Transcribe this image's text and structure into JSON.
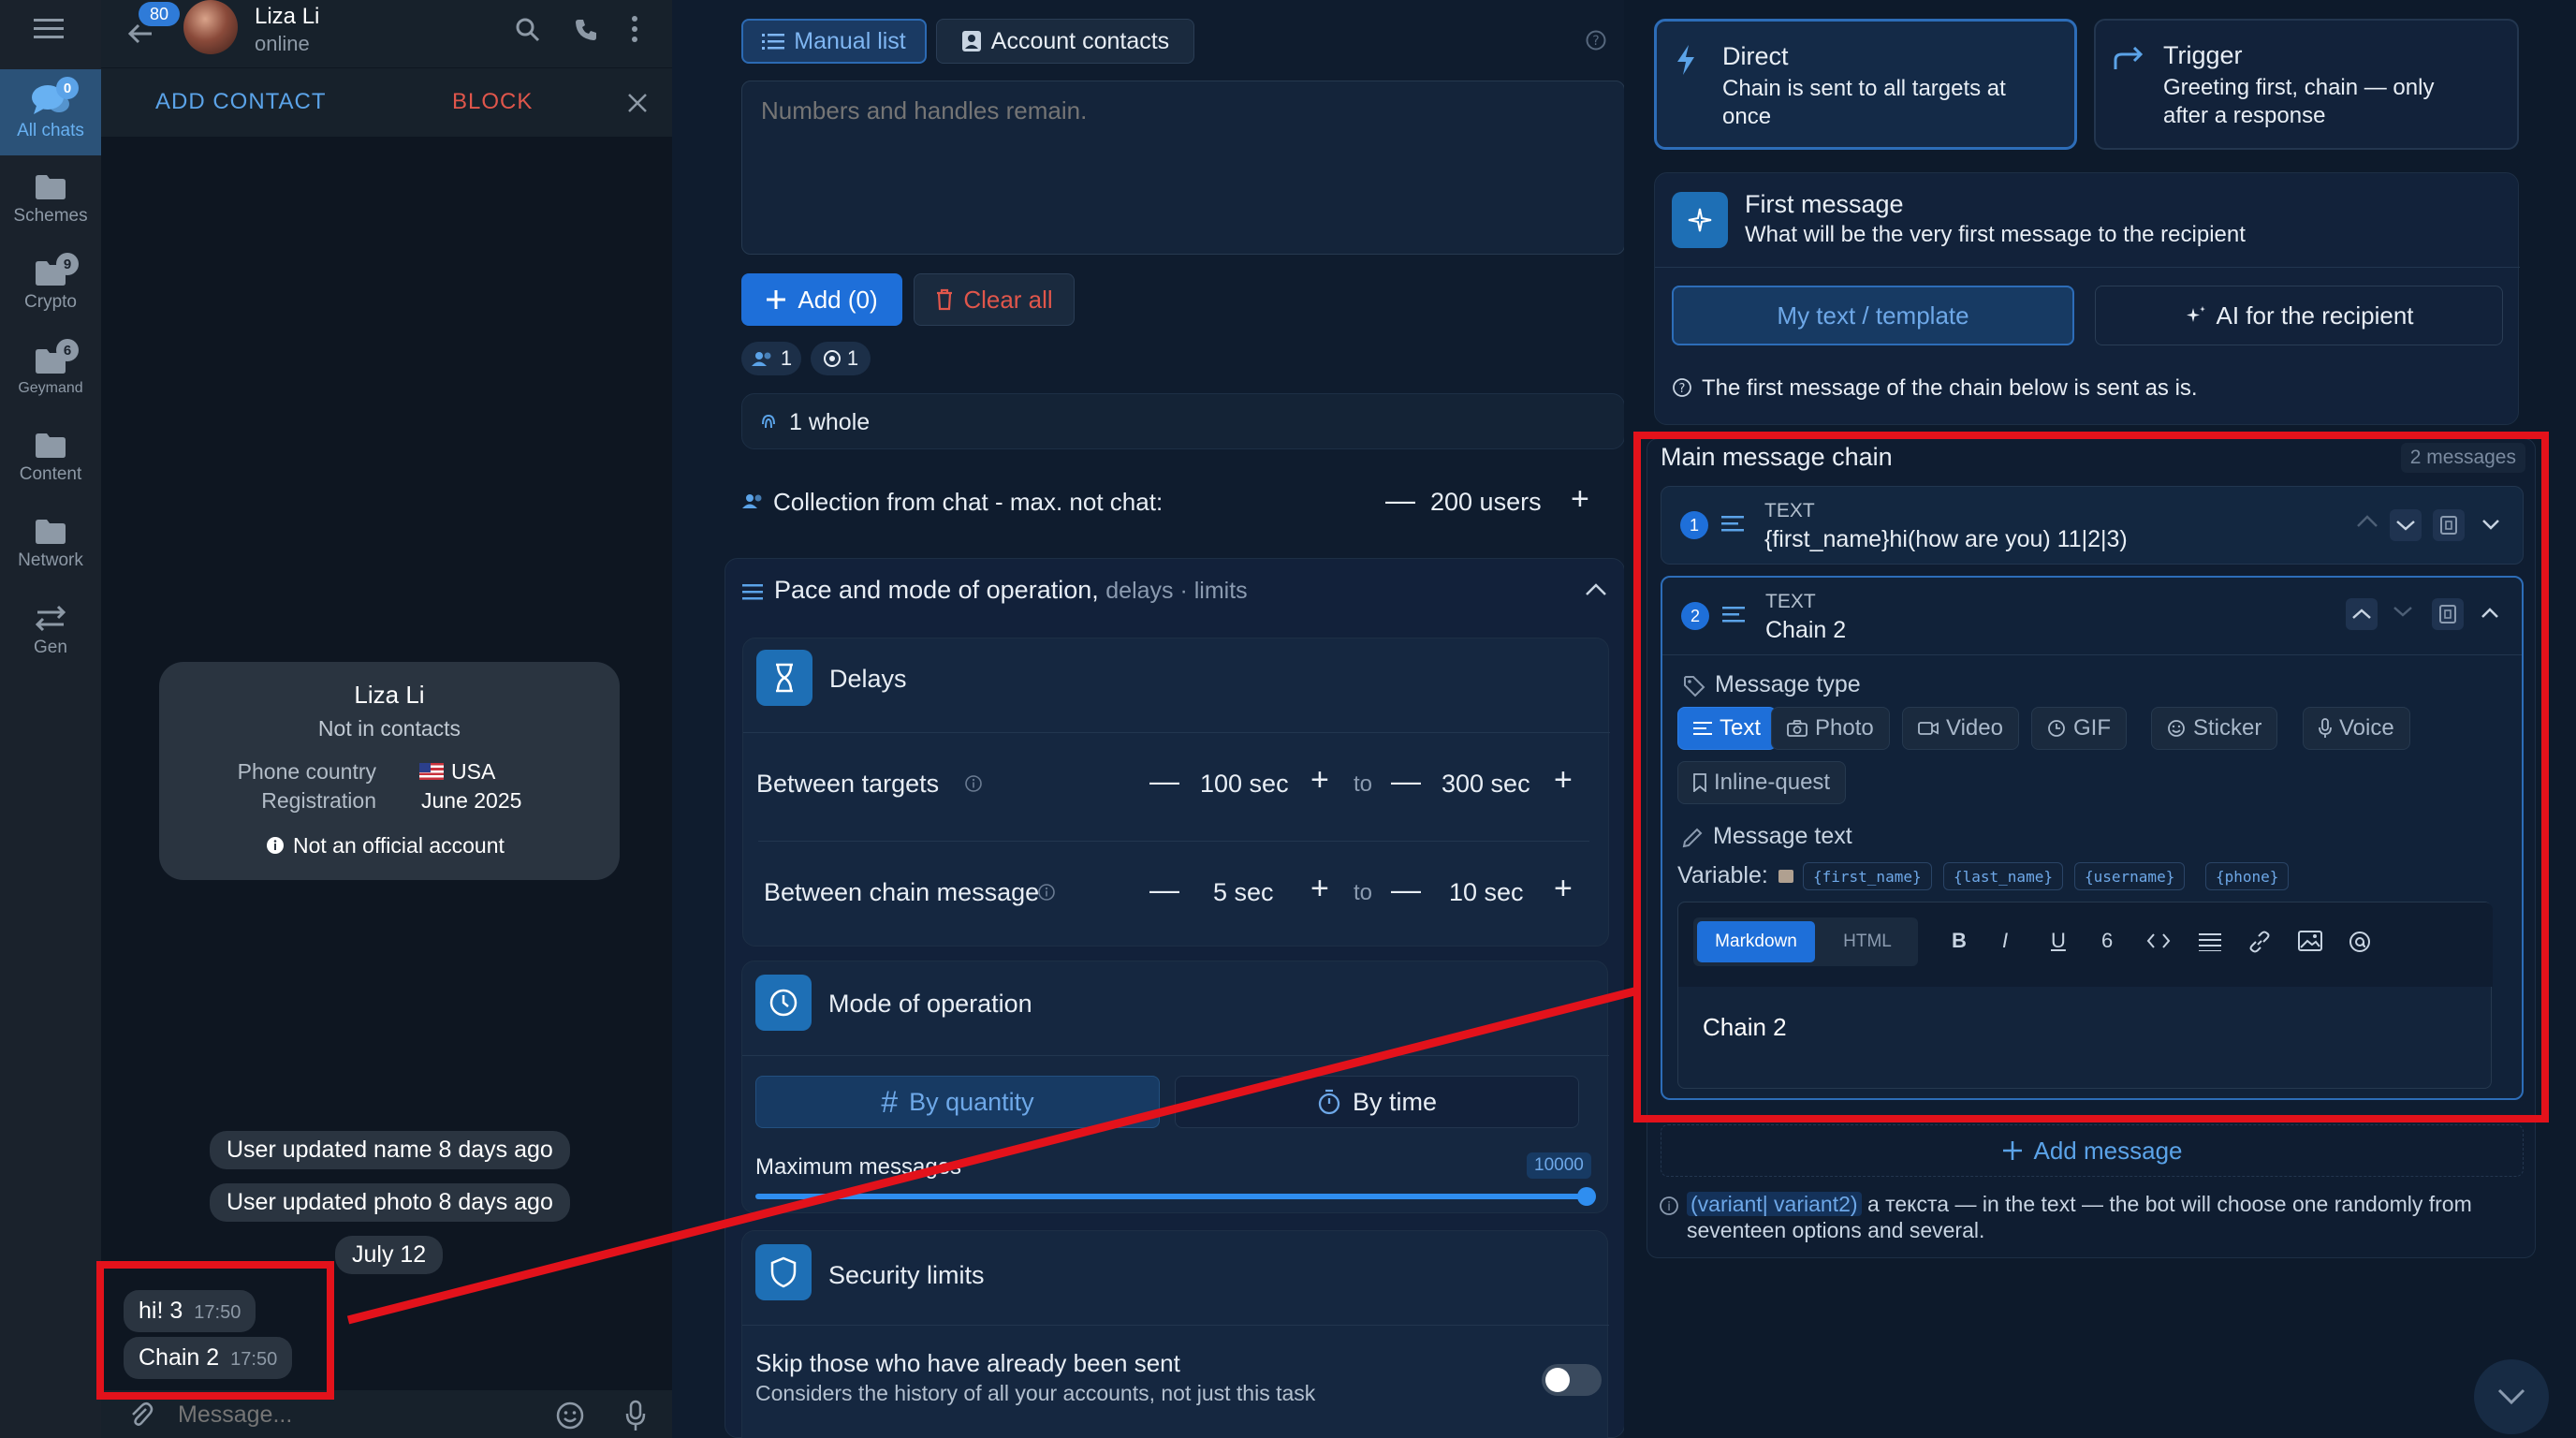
{
  "left_rail": {
    "items": [
      {
        "label": "All chats",
        "badge": "0",
        "icon": "chat-bubbles-icon"
      },
      {
        "label": "Schemes",
        "badge": "",
        "icon": "folder-icon"
      },
      {
        "label": "Crypto",
        "badge": "9",
        "icon": "folder-icon"
      },
      {
        "label": "Geymand",
        "badge": "6",
        "icon": "folder-icon"
      },
      {
        "label": "Content",
        "badge": "",
        "icon": "folder-icon"
      },
      {
        "label": "Network",
        "badge": "",
        "icon": "folder-icon"
      },
      {
        "label": "Gen",
        "badge": "",
        "icon": "arrows-swap-icon"
      }
    ]
  },
  "chat": {
    "back_badge": "80",
    "contact_name": "Liza Li",
    "status": "online",
    "add_contact": "ADD CONTACT",
    "block": "BLOCK",
    "card": {
      "name": "Liza Li",
      "subtitle": "Not in contacts",
      "phone_country_label": "Phone country",
      "phone_country_value": "USA",
      "registration_label": "Registration",
      "registration_value": "June 2025",
      "official_note": "Not an official account"
    },
    "service_messages": [
      "User updated name 8 days ago",
      "User updated photo 8 days ago"
    ],
    "date_pill": "July 12",
    "messages": [
      {
        "text": "hi! 3",
        "time": "17:50"
      },
      {
        "text": "Chain 2",
        "time": "17:50"
      }
    ],
    "composer_placeholder": "Message..."
  },
  "middle": {
    "tabs": [
      "Manual list",
      "Account contacts"
    ],
    "textarea_placeholder": "Numbers and handles remain.",
    "add_button": "Add (0)",
    "clear_button": "Clear all",
    "count_a": "1",
    "count_b": "1",
    "whole_label": "1 whole",
    "collection_label": "Collection from chat - max. not chat:",
    "collection_value": "200 users",
    "pace_title": "Pace and mode of operation,",
    "pace_subtitle": "delays · limits",
    "delays_title": "Delays",
    "between_targets_label": "Between targets",
    "between_targets_from": "100 sec",
    "between_targets_to": "300 sec",
    "between_chain_label": "Between chain message",
    "between_chain_from": "5 sec",
    "between_chain_to": "10 sec",
    "to_word": "to",
    "mode_title": "Mode of operation",
    "by_quantity": "By quantity",
    "by_time": "By time",
    "max_messages_label": "Maximum messages",
    "max_messages_value": "10000",
    "max_messages_fraction": 1.0,
    "security_title": "Security limits",
    "skip_title": "Skip those who have already been sent",
    "skip_subtitle": "Considers the history of all your accounts, not just this task",
    "skip_enabled": false
  },
  "right": {
    "direct_title": "Direct",
    "direct_desc_1": "Chain is sent to all targets at",
    "direct_desc_2": "once",
    "trigger_title": "Trigger",
    "trigger_desc_1": "Greeting first, chain — only",
    "trigger_desc_2": "after a response",
    "first_message_title": "First message",
    "first_message_desc": "What will be the very first message to the recipient",
    "my_text_button": "My text / template",
    "ai_button": "AI for the recipient",
    "first_message_note": "The first message of the chain below is sent as is.",
    "chain_title": "Main message chain",
    "chain_count": "2 messages",
    "msg1": {
      "num": "1",
      "type": "TEXT",
      "text": "{first_name}hi(how are you) 11|2|3)"
    },
    "msg2": {
      "num": "2",
      "type": "TEXT",
      "text": "Chain 2"
    },
    "message_type_label": "Message type",
    "type_chips": [
      "Text",
      "Photo",
      "Video",
      "GIF",
      "Sticker",
      "Voice",
      "Inline-quest"
    ],
    "message_text_label": "Message text",
    "variable_label": "Variable:",
    "variables": [
      "{first_name}",
      "{last_name}",
      "{username}",
      "{phone}"
    ],
    "editor_modes": [
      "Markdown",
      "HTML"
    ],
    "toolbar": {
      "bold": "B",
      "italic": "I",
      "underline": "U",
      "strike": "6"
    },
    "editor_text": "Chain 2",
    "add_message": "Add message",
    "footer_highlight": "(variant| variant2)",
    "footer_text_1": "a текста — in the text — the bot will choose one randomly from",
    "footer_text_2": "seventeen options and several."
  },
  "colors": {
    "accent": "#1e6fd9",
    "annotation_red": "#e3121b",
    "block_red": "#e0564b",
    "link_blue": "#5ba3e8"
  }
}
